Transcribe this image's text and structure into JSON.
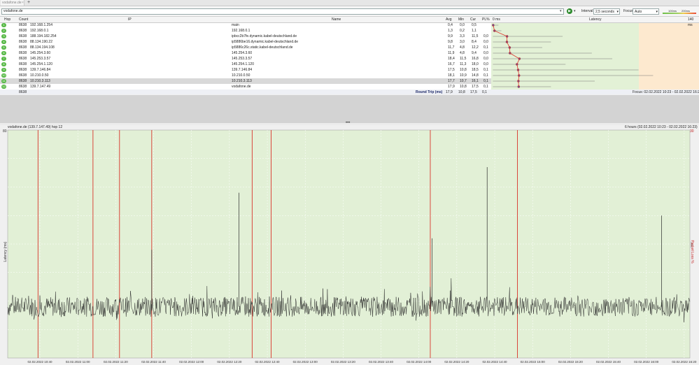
{
  "tab": {
    "title": "vodafone.de",
    "close": "×",
    "add": "+"
  },
  "toolbar": {
    "target": "vodafone.de",
    "interval_label": "Interval",
    "interval_value": "2,5 seconds",
    "focus_label": "Focus",
    "focus_value": "Auto",
    "scale_low": "100ms",
    "scale_high": "200ms"
  },
  "table": {
    "headers": {
      "hop": "Hop",
      "count": "Count",
      "ip": "IP",
      "name": "Name",
      "avg": "Avg",
      "min": "Min",
      "cur": "Cur",
      "pl": "PL%",
      "latency": "Latency",
      "lat_min": "0 ms",
      "lat_max": "140 ms"
    },
    "rows": [
      {
        "hop": "1",
        "count": "8638",
        "ip": "192.168.1.254",
        "name": "main",
        "avg": "0,4",
        "min": "0,0",
        "cur": "0,5",
        "pl": "",
        "avg_ms": 0.4,
        "max_ms": 4
      },
      {
        "hop": "2",
        "count": "8638",
        "ip": "192.168.0.1",
        "name": "192.168.0.1",
        "avg": "1,3",
        "min": "0,2",
        "cur": "1,1",
        "pl": "",
        "avg_ms": 1.3,
        "max_ms": 6
      },
      {
        "hop": "3",
        "count": "8638",
        "ip": "188.194.182.254",
        "name": "ipbcc2b7fe.dynamic.kabel-deutschland.de",
        "avg": "9,9",
        "min": "3,3",
        "cur": "11,5",
        "pl": "0,0",
        "avg_ms": 9.9,
        "max_ms": 48
      },
      {
        "hop": "4",
        "count": "8638",
        "ip": "88.134.190.22",
        "name": "ip5886be16.dynamic.kabel-deutschland.de",
        "avg": "9,8",
        "min": "3,0",
        "cur": "8,4",
        "pl": "0,0",
        "avg_ms": 9.8,
        "max_ms": 40
      },
      {
        "hop": "5",
        "count": "8638",
        "ip": "88.134.194.108",
        "name": "ip5886c26c.static.kabel-deutschland.de",
        "avg": "11,7",
        "min": "4,8",
        "cur": "12,2",
        "pl": "0,1",
        "avg_ms": 11.7,
        "max_ms": 34
      },
      {
        "hop": "6",
        "count": "8638",
        "ip": "145.254.3.60",
        "name": "145.254.3.60",
        "avg": "11,9",
        "min": "4,8",
        "cur": "9,4",
        "pl": "0,0",
        "avg_ms": 11.9,
        "max_ms": 68
      },
      {
        "hop": "7",
        "count": "8638",
        "ip": "145.253.3.57",
        "name": "145.253.3.57",
        "avg": "18,4",
        "min": "11,5",
        "cur": "16,8",
        "pl": "0,0",
        "avg_ms": 18.4,
        "max_ms": 82
      },
      {
        "hop": "8",
        "count": "8638",
        "ip": "145.254.1.120",
        "name": "145.254.1.120",
        "avg": "16,7",
        "min": "11,3",
        "cur": "18,0",
        "pl": "0,0",
        "avg_ms": 16.7,
        "max_ms": 50
      },
      {
        "hop": "9",
        "count": "8638",
        "ip": "139.7.146.84",
        "name": "139.7.146.84",
        "avg": "17,5",
        "min": "10,8",
        "cur": "18,5",
        "pl": "0,1",
        "avg_ms": 17.5,
        "max_ms": 100
      },
      {
        "hop": "10",
        "count": "8638",
        "ip": "10.210.0.50",
        "name": "10.210.0.50",
        "avg": "18,1",
        "min": "10,9",
        "cur": "14,8",
        "pl": "0,1",
        "avg_ms": 18.1,
        "max_ms": 110
      },
      {
        "hop": "11",
        "count": "8638",
        "ip": "10.210.3.113",
        "name": "10.210.3.113",
        "avg": "17,7",
        "min": "10,7",
        "cur": "16,1",
        "pl": "0,1",
        "avg_ms": 17.7,
        "max_ms": 70
      },
      {
        "hop": "12",
        "count": "8638",
        "ip": "139.7.147.49",
        "name": "vodafone.de",
        "avg": "17,9",
        "min": "10,8",
        "cur": "17,5",
        "pl": "0,1",
        "avg_ms": 17.9,
        "max_ms": 40
      }
    ],
    "summary": {
      "count": "8638",
      "label": "Round Trip (ms)",
      "avg": "17,9",
      "min": "10,8",
      "cur": "17,5",
      "pl": "0,1",
      "focus": "Focus: 02.02.2022 10:23 - 02.02.2022 16:23"
    }
  },
  "graph": {
    "title": "vodafone.de (139.7.147.49) hop 12",
    "range": "6 hours (02.02.2022 10:23 - 02.02.2022 16:23)",
    "ylabel": "Latency (ms)",
    "ylabel_right": "Packet Loss %",
    "y_max_left": "80",
    "y_max_right": "30",
    "x_labels": [
      "02.02.2022 10:40",
      "02.02.2022 11:00",
      "02.02.2022 11:20",
      "02.02.2022 11:40",
      "02.02.2022 12:00",
      "02.02.2022 12:20",
      "02.02.2022 12:40",
      "02.02.2022 13:00",
      "02.02.2022 13:20",
      "02.02.2022 13:40",
      "02.02.2022 14:00",
      "02.02.2022 14:20",
      "02.02.2022 14:40",
      "02.02.2022 15:00",
      "02.02.2022 15:20",
      "02.02.2022 15:40",
      "02.02.2022 16:00",
      "02.02.2022 16:20"
    ],
    "colors": {
      "green": "#e2f0d6",
      "red": "#d9342b",
      "line": "#2b2b2b"
    }
  },
  "chart_data": {
    "type": "line",
    "title": "vodafone.de (139.7.147.49) hop 12",
    "ylabel": "Latency (ms)",
    "ylim": [
      0,
      80
    ],
    "baseline_ms": 18,
    "loss_marker_minutes": [
      16,
      45,
      59,
      76,
      129,
      139,
      223,
      269
    ],
    "spike_markers": [
      {
        "minute": 76,
        "ms": 38
      },
      {
        "minute": 122,
        "ms": 58
      },
      {
        "minute": 224,
        "ms": 42
      },
      {
        "minute": 253,
        "ms": 67
      },
      {
        "minute": 345,
        "ms": 50
      }
    ]
  }
}
